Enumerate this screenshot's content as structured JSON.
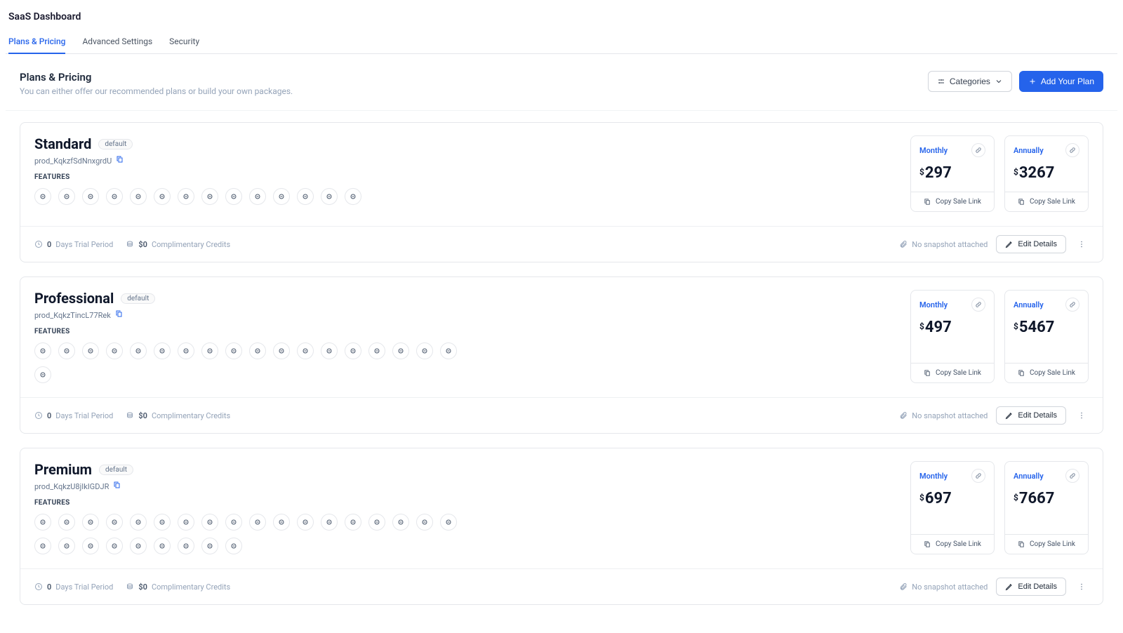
{
  "app_title": "SaaS Dashboard",
  "tabs": [
    {
      "label": "Plans & Pricing",
      "active": true
    },
    {
      "label": "Advanced Settings",
      "active": false
    },
    {
      "label": "Security",
      "active": false
    }
  ],
  "section": {
    "title": "Plans & Pricing",
    "subtitle": "You can either offer our recommended plans or build your own packages."
  },
  "actions": {
    "categories_label": "Categories",
    "add_plan_label": "Add Your Plan"
  },
  "common": {
    "features_label": "FEATURES",
    "default_badge": "default",
    "monthly_label": "Monthly",
    "annually_label": "Annually",
    "copy_sale_link": "Copy Sale Link",
    "trial_prefix": "0",
    "trial_suffix": "Days Trial Period",
    "credits_prefix": "$0",
    "credits_suffix": "Complimentary Credits",
    "snapshot_text": "No snapshot attached",
    "edit_label": "Edit Details",
    "currency": "$"
  },
  "plans": [
    {
      "name": "Standard",
      "id": "prod_KqkzfSdNnxgrdU",
      "feature_count": 14,
      "monthly": "297",
      "annually": "3267"
    },
    {
      "name": "Professional",
      "id": "prod_KqkzTincL77Rek",
      "feature_count": 19,
      "monthly": "497",
      "annually": "5467"
    },
    {
      "name": "Premium",
      "id": "prod_KqkzU8jIkIGDJR",
      "feature_count": 27,
      "monthly": "697",
      "annually": "7667"
    }
  ]
}
